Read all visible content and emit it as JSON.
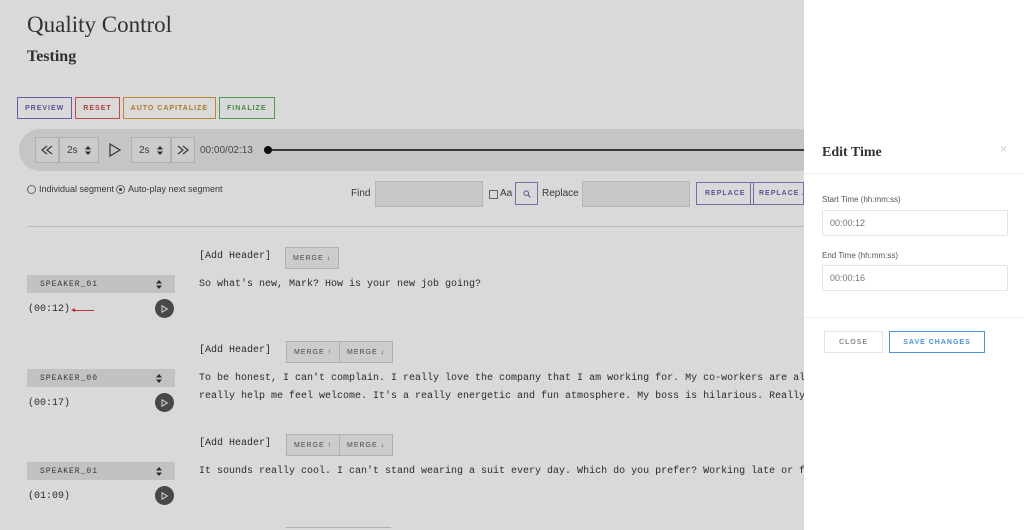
{
  "header": {
    "title": "Quality Control",
    "subtitle": "Testing"
  },
  "toolbar": {
    "preview": "PREVIEW",
    "reset": "RESET",
    "auto_capitalize": "AUTO CAPITALIZE",
    "finalize": "FINALIZE"
  },
  "player": {
    "rewind_step": "2s",
    "forward_step": "2s",
    "current_time": "00:00",
    "separator": "/",
    "duration": "02:13",
    "progress_fraction": 0
  },
  "options": {
    "individual_segment": "Individual segment",
    "auto_play_next": "Auto-play next segment",
    "selected": "auto_play_next"
  },
  "find_replace": {
    "find_label": "Find",
    "match_case_label": "Aa",
    "replace_label": "Replace",
    "replace_button": "REPLACE",
    "replace_all_button": "REPLACE ALL"
  },
  "segments": [
    {
      "header": "[Add Header]",
      "merge_up": "",
      "merge_down": "MERGE ↓",
      "speaker": "SPEAKER_01",
      "time": "(00:12)",
      "active": true,
      "lines": [
        "So what's new, Mark? How is your new job going?"
      ]
    },
    {
      "header": "[Add Header]",
      "merge_up": "MERGE ↑",
      "merge_down": "MERGE ↓",
      "speaker": "SPEAKER_00",
      "time": "(00:17)",
      "active": false,
      "lines": [
        "To be honest, I can't complain. I really love the company that I am working for. My co-workers are all really friendly and",
        "really help me feel welcome. It's a really energetic and fun atmosphere. My boss is hilarious. Really? How about the dress code?"
      ]
    },
    {
      "header": "[Add Header]",
      "merge_up": "MERGE ↑",
      "merge_down": "MERGE ↓",
      "speaker": "SPEAKER_01",
      "time": "(01:09)",
      "active": false,
      "lines": [
        "It sounds really cool. I can't stand wearing a suit every day. Which do you prefer? Working late or finishing early?"
      ]
    }
  ],
  "modal": {
    "title": "Edit Time",
    "close_symbol": "×",
    "start_label": "Start Time (hh:mm:ss)",
    "start_value": "00:00:12",
    "end_label": "End Time (hh:mm:ss)",
    "end_value": "00:00:16",
    "close_button": "CLOSE",
    "save_button": "SAVE CHANGES"
  },
  "colors": {
    "preview": "#7b6fc4",
    "reset": "#e05a5a",
    "auto_capitalize": "#e0a23a",
    "finalize": "#5cb85c",
    "save": "#4a90e2"
  }
}
